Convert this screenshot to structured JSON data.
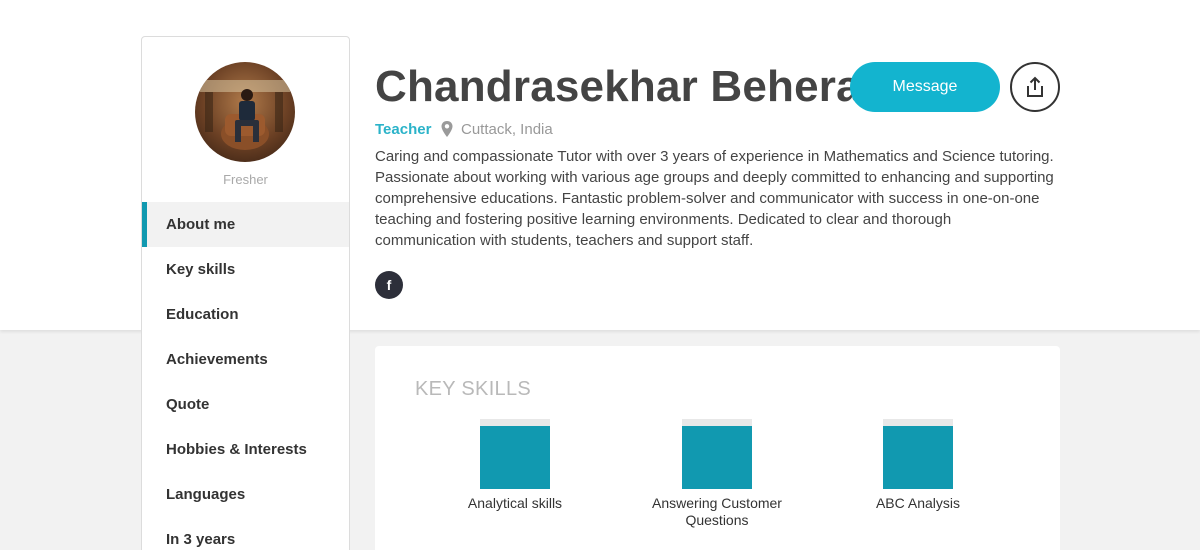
{
  "profile": {
    "name": "Chandrasekhar Behera",
    "role": "Teacher",
    "location": "Cuttack, India",
    "status": "Fresher",
    "bio": "Caring and compassionate Tutor with over 3 years of experience in Mathematics and Science tutoring. Passionate about working with various age groups and deeply committed to enhancing and supporting comprehensive educations. Fantastic problem-solver and communicator with success in one-on-one teaching and fostering positive learning environments. Dedicated to clear and thorough communication with students, teachers and support staff.",
    "social": {
      "facebook_glyph": "f"
    }
  },
  "actions": {
    "message_label": "Message",
    "share_icon": "share-icon"
  },
  "nav": {
    "items": [
      {
        "label": "About me",
        "active": true
      },
      {
        "label": "Key skills",
        "active": false
      },
      {
        "label": "Education",
        "active": false
      },
      {
        "label": "Achievements",
        "active": false
      },
      {
        "label": "Quote",
        "active": false
      },
      {
        "label": "Hobbies & Interests",
        "active": false
      },
      {
        "label": "Languages",
        "active": false
      },
      {
        "label": "In 3 years",
        "active": false
      }
    ]
  },
  "skills": {
    "title": "KEY SKILLS",
    "items": [
      {
        "label": "Analytical skills",
        "level": 0.9
      },
      {
        "label": "Answering Customer Questions",
        "level": 0.9
      },
      {
        "label": "ABC Analysis",
        "level": 0.9
      }
    ]
  },
  "colors": {
    "accent": "#13b4cf",
    "skill_fill": "#1199b0",
    "role_text": "#2bb3c9"
  }
}
